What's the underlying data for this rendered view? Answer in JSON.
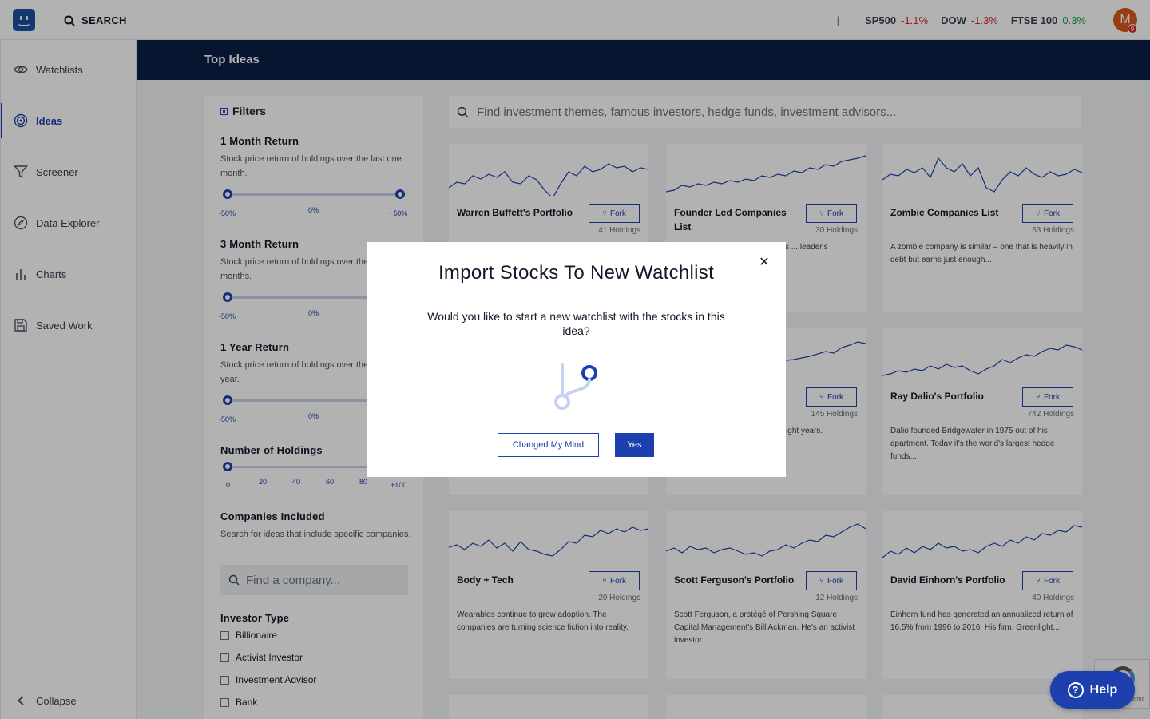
{
  "header": {
    "search_label": "SEARCH",
    "separator": "|",
    "tickers": [
      {
        "name": "SP500",
        "change": "-1.1%",
        "dir": "neg"
      },
      {
        "name": "DOW",
        "change": "-1.3%",
        "dir": "neg"
      },
      {
        "name": "FTSE 100",
        "change": "0.3%",
        "dir": "pos"
      }
    ],
    "avatar_initial": "M",
    "notification_count": "9"
  },
  "sidebar": {
    "items": [
      {
        "label": "Watchlists",
        "icon": "eye-icon"
      },
      {
        "label": "Ideas",
        "icon": "target-icon",
        "active": true
      },
      {
        "label": "Screener",
        "icon": "filter-icon"
      },
      {
        "label": "Data Explorer",
        "icon": "compass-icon"
      },
      {
        "label": "Charts",
        "icon": "bar-chart-icon"
      },
      {
        "label": "Saved Work",
        "icon": "save-icon"
      }
    ],
    "collapse_label": "Collapse"
  },
  "page": {
    "title": "Top Ideas"
  },
  "filters": {
    "heading": "Filters",
    "one_month": {
      "title": "1 Month Return",
      "desc": "Stock price return of holdings over the last one month.",
      "labels": [
        "-50%",
        "0%",
        "+50%"
      ]
    },
    "three_month": {
      "title": "3 Month Return",
      "desc": "Stock price return of holdings over the last three months.",
      "labels": [
        "-50%",
        "0%"
      ]
    },
    "one_year": {
      "title": "1 Year Return",
      "desc": "Stock price return of holdings over the last one year.",
      "labels": [
        "-50%",
        "0%"
      ]
    },
    "holdings": {
      "title": "Number of Holdings",
      "labels": [
        "0",
        "20",
        "40",
        "60",
        "80",
        "+100"
      ]
    },
    "companies": {
      "title": "Companies Included",
      "desc": "Search for ideas that include specific companies.",
      "placeholder": "Find a company..."
    },
    "investor_type": {
      "title": "Investor Type",
      "options": [
        "Billionaire",
        "Activist Investor",
        "Investment Advisor",
        "Bank"
      ]
    }
  },
  "main_search": {
    "placeholder": "Find investment themes, famous investors, hedge funds, investment advisors..."
  },
  "fork_label": "Fork",
  "cards": [
    {
      "name": "Warren Buffett's Portfolio",
      "holdings": "41 Holdings",
      "desc": ""
    },
    {
      "name": "Founder Led Companies List",
      "holdings": "30 Holdings",
      "desc": "Companies led by their founders ... leader's"
    },
    {
      "name": "Zombie Companies List",
      "holdings": "63 Holdings",
      "desc": "A zombie company is similar – one that is heavily in debt but earns just enough..."
    },
    {
      "name": "",
      "holdings": "145 Holdings",
      "desc": "Stocks that have paid ... 25 straight years."
    },
    {
      "name": "Ray Dalio's Portfolio",
      "holdings": "742 Holdings",
      "desc": "Dalio founded Bridgewater in 1975 out of his apartment. Today it's the world's largest hedge funds..."
    },
    {
      "name": "Body + Tech",
      "holdings": "20 Holdings",
      "desc": "Wearables continue to grow adoption. The companies are turning science fiction into reality."
    },
    {
      "name": "Scott Ferguson's Portfolio",
      "holdings": "12 Holdings",
      "desc": "Scott Ferguson, a protégé of Pershing Square Capital Management's Bill Ackman. He's an activist investor."
    },
    {
      "name": "David Einhorn's Portfolio",
      "holdings": "40 Holdings",
      "desc": "Einhorn fund has generated an annualized return of 16.5% from 1996 to 2016. His firm, Greenlight..."
    }
  ],
  "modal": {
    "title": "Import Stocks To New Watchlist",
    "text": "Would you like to start a new watchlist with the stocks in this idea?",
    "icon": "git-fork-icon",
    "cancel_label": "Changed My Mind",
    "confirm_label": "Yes"
  },
  "help": {
    "label": "Help"
  },
  "recaptcha": {
    "terms": "Terms"
  },
  "colors": {
    "primary": "#1e40af",
    "header_band": "#0b1f45",
    "negative": "#dc2626",
    "positive": "#16a34a"
  }
}
